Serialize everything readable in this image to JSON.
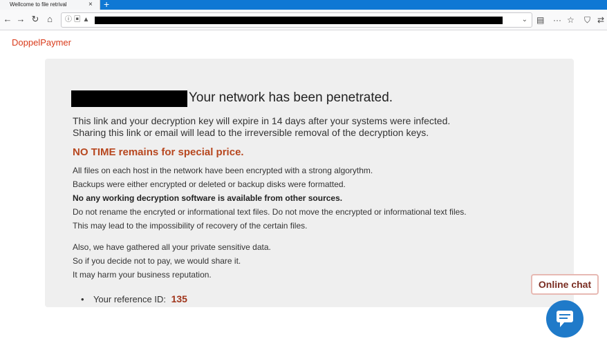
{
  "browser": {
    "tab_title": "Wellcome to file retrival",
    "tab_close": "×",
    "new_tab": "+",
    "back": "←",
    "forward": "→",
    "reload": "↻",
    "home": "⌂",
    "url_icons": "ⓘ ▣ ▲",
    "url_dropdown": "⌄",
    "reader": "▤",
    "more": "···",
    "bookmark": "☆",
    "shield": "⛉",
    "extension": "⇄"
  },
  "page": {
    "brand": "DoppelPaymer",
    "headline": "Your network has been penetrated.",
    "expire_lines": [
      "This link and your decryption key will expire in 14 days after your systems were infected.",
      "Sharing this link or email will lead to the irreversible removal of the decryption keys."
    ],
    "notime": "NO TIME remains for special price.",
    "para1": [
      "All files on each host in the network have been encrypted with a strong algorythm.",
      "Backups were either encrypted or deleted or backup disks were formatted.",
      "No any working decryption software is available from other sources.",
      "Do not rename the encryted or informational text files. Do not move the encrypted or informational text files.",
      "This may lead to the impossibility of recovery of the certain files."
    ],
    "para2": [
      "Also, we have gathered all your private sensitive data.",
      "So if you decide not to pay, we would share it.",
      "It may harm your business reputation."
    ],
    "ref_label": "Your reference ID:",
    "ref_id": "135",
    "bullet": "•"
  },
  "chat": {
    "label": "Online chat",
    "icon": "chat-bubble-icon",
    "button_color": "#1f7ac9"
  },
  "colors": {
    "brand": "#d93a1a",
    "alert": "#b7471f",
    "accent": "#0f78d4"
  }
}
